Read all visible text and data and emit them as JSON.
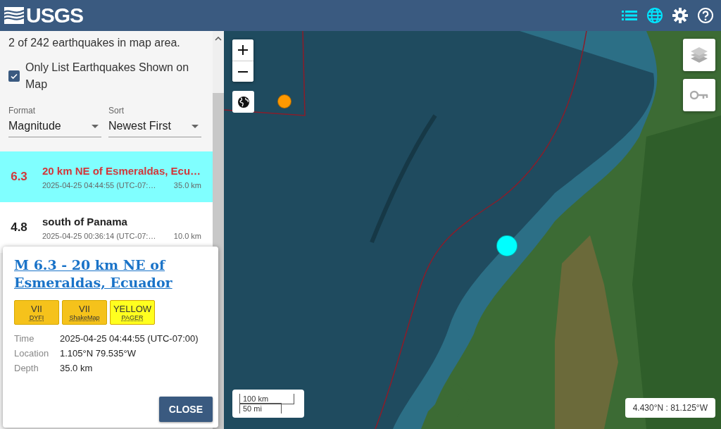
{
  "header": {
    "logo": "USGS"
  },
  "list": {
    "summary": "2 of 242 earthquakes in map area.",
    "only_shown": {
      "label": "Only List Earthquakes Shown on Map",
      "checked": true
    },
    "format": {
      "label": "Format",
      "value": "Magnitude"
    },
    "sort": {
      "label": "Sort",
      "value": "Newest First"
    },
    "events": [
      {
        "magnitude": "6.3",
        "place": "20 km NE of Esmeraldas, Ecu…",
        "time": "2025-04-25 04:44:55 (UTC-07:…",
        "depth": "35.0 km",
        "selected": true
      },
      {
        "magnitude": "4.8",
        "place": "south of Panama",
        "time": "2025-04-25 00:36:14 (UTC-07:…",
        "depth": "10.0 km",
        "selected": false
      }
    ]
  },
  "popup": {
    "title": "M 6.3 - 20 km NE of Esmeraldas, Ecuador",
    "badges": [
      {
        "value": "VII",
        "label": "DYFI",
        "color": "#f5c21b"
      },
      {
        "value": "VII",
        "label": "ShakeMap",
        "color": "#f5c21b"
      },
      {
        "value": "YELLOW",
        "label": "PAGER",
        "color": "#ffff1f"
      }
    ],
    "details": [
      {
        "label": "Time",
        "value": "2025-04-25 04:44:55 (UTC-07:00)"
      },
      {
        "label": "Location",
        "value": "1.105°N 79.535°W"
      },
      {
        "label": "Depth",
        "value": "35.0 km"
      }
    ],
    "close": "CLOSE"
  },
  "map": {
    "markers": [
      {
        "color": "#ff9900",
        "selected": false
      },
      {
        "color": "#00ffff",
        "selected": true
      }
    ],
    "scale": {
      "metric": "100 km",
      "imperial": "50 mi"
    },
    "coordinates": "4.430°N : 81.125°W"
  }
}
